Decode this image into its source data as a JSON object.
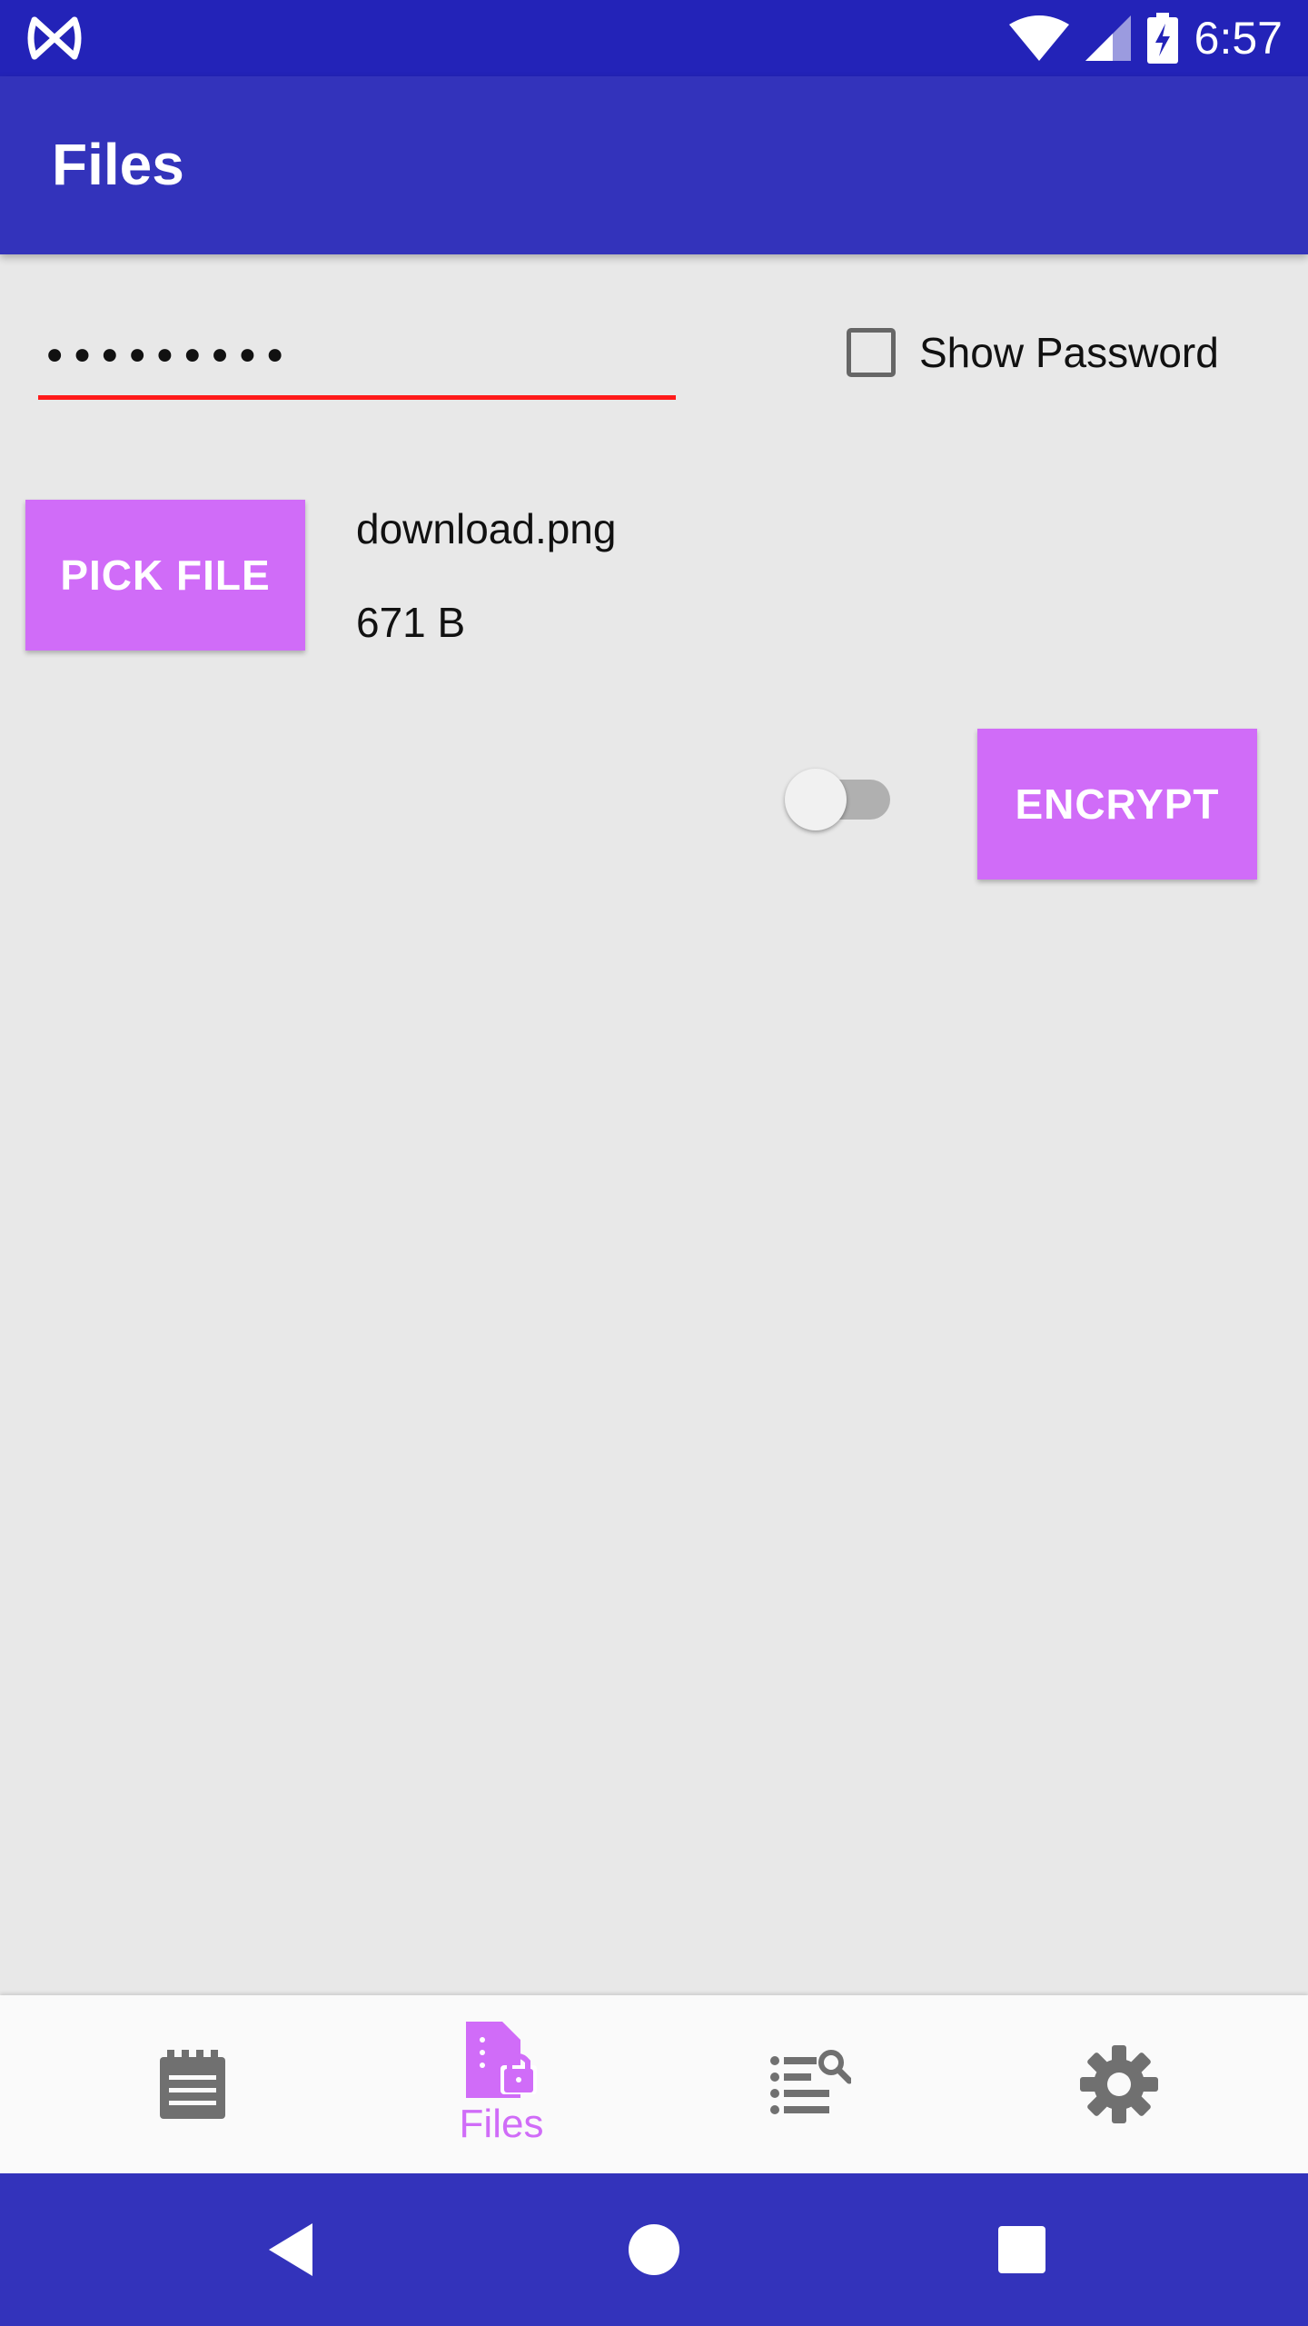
{
  "status_bar": {
    "time": "6:57",
    "icons": [
      "app-logo-icon",
      "wifi-icon",
      "signal-icon",
      "battery-charging-icon"
    ]
  },
  "app_bar": {
    "title": "Files"
  },
  "password": {
    "value": "•••••••••",
    "show_password_label": "Show Password",
    "show_password_checked": false
  },
  "file": {
    "pick_label": "PICK FILE",
    "name": "download.png",
    "size": "671 B"
  },
  "actions": {
    "toggle_on": false,
    "encrypt_label": "ENCRYPT"
  },
  "bottom_nav": {
    "items": [
      {
        "icon": "notes-icon",
        "label": "",
        "active": false
      },
      {
        "icon": "file-lock-icon",
        "label": "Files",
        "active": true
      },
      {
        "icon": "list-search-icon",
        "label": "",
        "active": false
      },
      {
        "icon": "gear-icon",
        "label": "",
        "active": false
      }
    ]
  },
  "colors": {
    "status_bar": "#2323b8",
    "app_bar": "#3333bb",
    "accent": "#d06cf8",
    "error_underline": "#ff1a1a",
    "background": "#e8e8e8"
  }
}
